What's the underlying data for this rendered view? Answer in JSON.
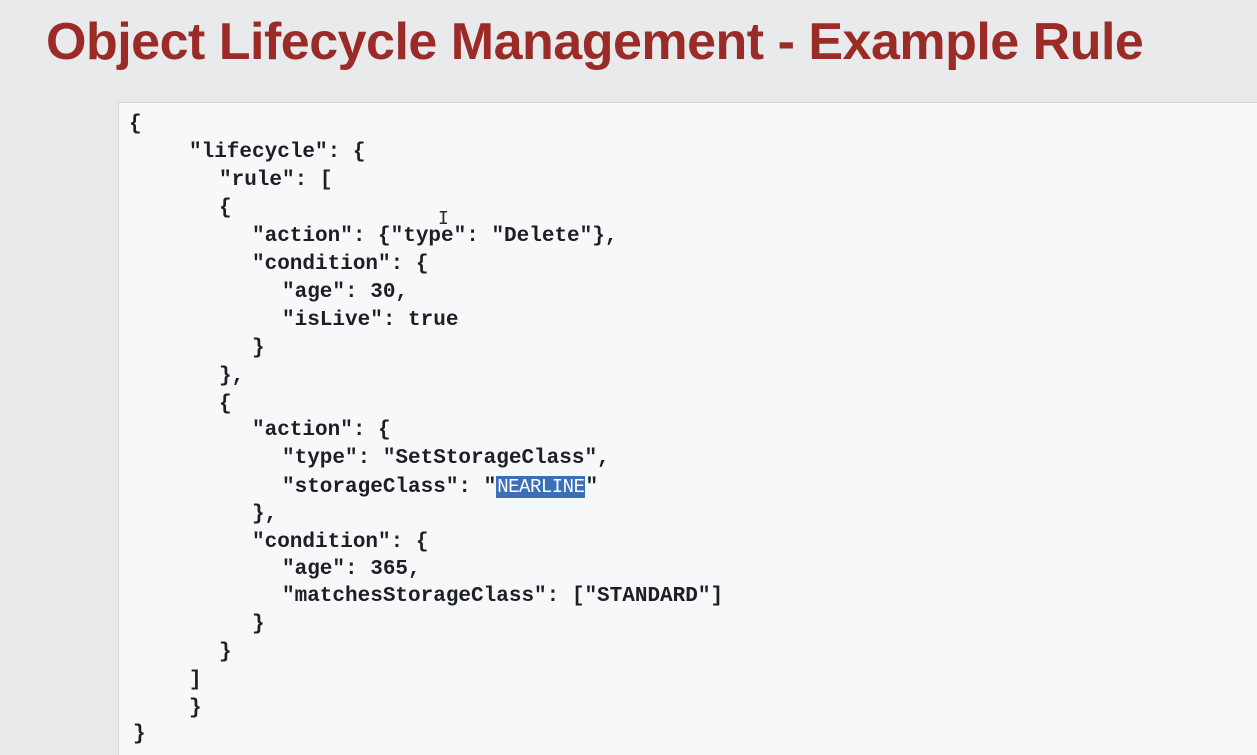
{
  "title": "Object Lifecycle Management - Example Rule",
  "code": {
    "lines": [
      "{",
      "\"lifecycle\": {",
      "\"rule\": [",
      "{",
      "\"action\": {\"type\": \"Delete\"},",
      "\"condition\": {",
      "\"age\": 30,",
      "\"isLive\": true",
      "}",
      "},",
      "{",
      "\"action\": {",
      "\"type\": \"SetStorageClass\",",
      "\"storageClass\": \"",
      "}",
      "\"condition\": {",
      "\"age\": 365,",
      "\"matchesStorageClass\": [\"STANDARD\"]",
      "}",
      "}",
      "]",
      "}",
      "}"
    ],
    "selected_text": "NEARLINE",
    "after_selection": "\"",
    "line_14_suffix": ","
  },
  "cursor_icon": "text-cursor-icon"
}
